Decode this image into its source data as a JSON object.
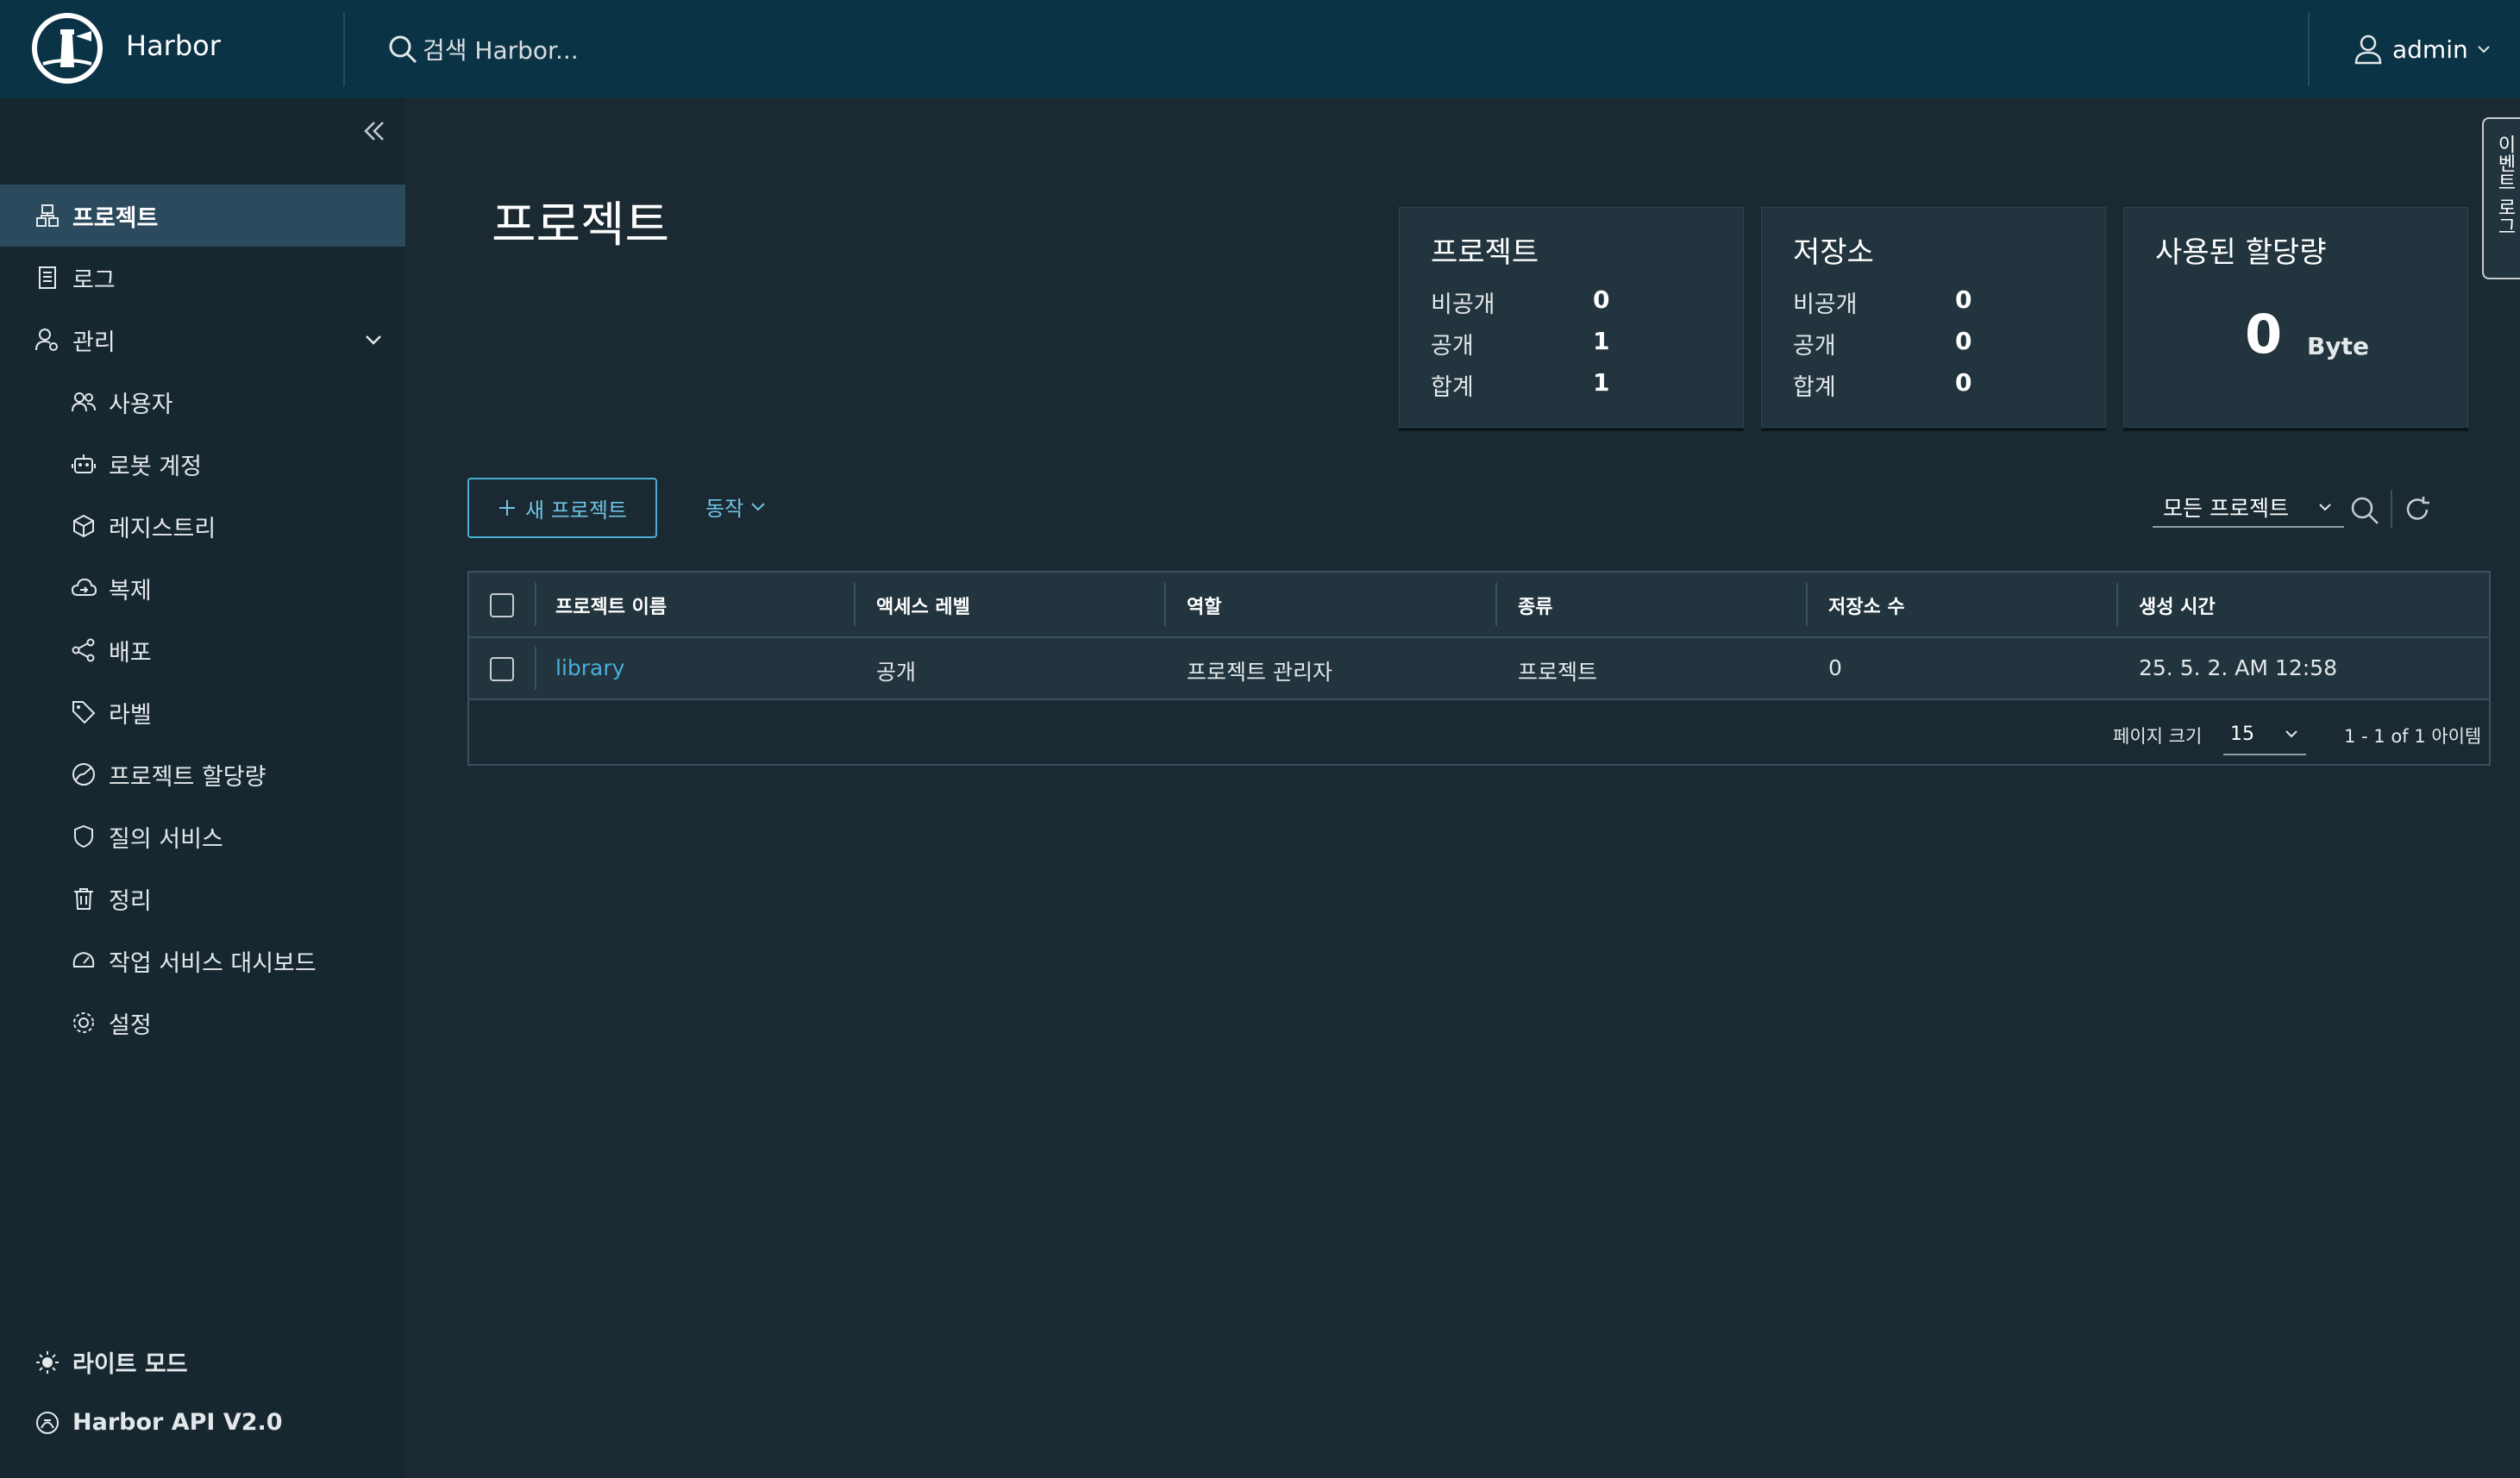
{
  "header": {
    "brand": "Harbor",
    "search_placeholder": "검색 Harbor...",
    "user": "admin"
  },
  "sidebar": {
    "items": [
      {
        "label": "프로젝트",
        "icon": "projects-icon",
        "active": true
      },
      {
        "label": "로그",
        "icon": "logs-icon"
      },
      {
        "label": "관리",
        "icon": "admin-icon",
        "expanded": true
      }
    ],
    "admin_items": [
      {
        "label": "사용자",
        "icon": "users-icon"
      },
      {
        "label": "로봇 계정",
        "icon": "robot-icon"
      },
      {
        "label": "레지스트리",
        "icon": "registry-icon"
      },
      {
        "label": "복제",
        "icon": "replication-icon"
      },
      {
        "label": "배포",
        "icon": "distribution-icon"
      },
      {
        "label": "라벨",
        "icon": "label-icon"
      },
      {
        "label": "프로젝트 할당량",
        "icon": "quota-icon"
      },
      {
        "label": "질의 서비스",
        "icon": "shield-icon"
      },
      {
        "label": "정리",
        "icon": "trash-icon"
      },
      {
        "label": "작업 서비스 대시보드",
        "icon": "dashboard-icon"
      },
      {
        "label": "설정",
        "icon": "gear-icon"
      }
    ],
    "light_mode": "라이트 모드",
    "api": "Harbor API V2.0"
  },
  "main": {
    "title": "프로젝트",
    "cards": {
      "projects": {
        "title": "프로젝트",
        "private_label": "비공개",
        "private": "0",
        "public_label": "공개",
        "public": "1",
        "total_label": "합계",
        "total": "1"
      },
      "repos": {
        "title": "저장소",
        "private_label": "비공개",
        "private": "0",
        "public_label": "공개",
        "public": "0",
        "total_label": "합계",
        "total": "0"
      },
      "quota": {
        "title": "사용된 할당량",
        "value": "0",
        "unit": "Byte"
      }
    },
    "new_project": "새 프로젝트",
    "action": "동작",
    "filter": "모든 프로젝트",
    "table": {
      "columns": [
        "프로젝트 이름",
        "액세스 레벨",
        "역할",
        "종류",
        "저장소 수",
        "생성 시간"
      ],
      "rows": [
        {
          "name": "library",
          "access": "공개",
          "role": "프로젝트 관리자",
          "type": "프로젝트",
          "repos": "0",
          "created": "25. 5. 2. AM 12:58"
        }
      ],
      "page_size_label": "페이지 크기",
      "page_size": "15",
      "pagination": "1 - 1 of 1 아이템"
    }
  },
  "event_log": "이벤트 로그",
  "colors": {
    "header_bg": "#0b3346",
    "sidebar_bg": "#172730",
    "accent": "#49afd9",
    "active_nav": "#2b4a5e"
  }
}
